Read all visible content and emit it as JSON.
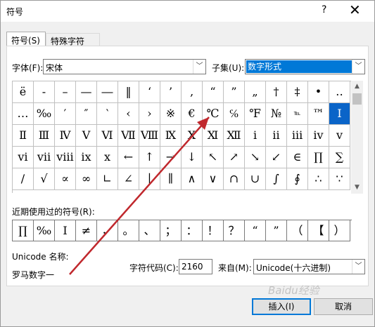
{
  "title": "符号",
  "help_glyph": "?",
  "close_glyph": "✕",
  "tabs": [
    "符号(S)",
    "特殊字符(P)"
  ],
  "font": {
    "label": "字体(F):",
    "value": "宋体"
  },
  "subset": {
    "label": "子集(U):",
    "value": "数字形式"
  },
  "symbols": [
    [
      "ë",
      "-",
      "–",
      "—",
      "―",
      "‖",
      "‘",
      "’",
      "‚",
      "“",
      "”",
      "„",
      "†",
      "‡",
      "•",
      "‥"
    ],
    [
      "…",
      "‰",
      "′",
      "″",
      "‵",
      "‹",
      "›",
      "※",
      "€",
      "℃",
      "℅",
      "℉",
      "№",
      "℡",
      "™",
      "Ⅰ"
    ],
    [
      "Ⅱ",
      "Ⅲ",
      "Ⅳ",
      "Ⅴ",
      "Ⅵ",
      "Ⅶ",
      "Ⅷ",
      "Ⅸ",
      "Ⅹ",
      "Ⅺ",
      "Ⅻ",
      "ⅰ",
      "ⅱ",
      "ⅲ",
      "ⅳ",
      "ⅴ"
    ],
    [
      "ⅵ",
      "ⅶ",
      "ⅷ",
      "ⅸ",
      "ⅹ",
      "←",
      "↑",
      "→",
      "↓",
      "↖",
      "↗",
      "↘",
      "↙",
      "∈",
      "∏",
      "∑"
    ],
    [
      "∕",
      "√",
      "∝",
      "∞",
      "∟",
      "∠",
      "∣",
      "∥",
      "∧",
      "∨",
      "∩",
      "∪",
      "∫",
      "∮",
      "∴",
      "∵"
    ]
  ],
  "selected_symbol": "Ⅰ",
  "recent": {
    "label": "近期使用过的符号(R):",
    "items": [
      "∏",
      "‰",
      "Ⅰ",
      "≠",
      "，",
      "。",
      "、",
      "；",
      "：",
      "！",
      "？",
      "“",
      "”",
      "（",
      "【",
      "）"
    ]
  },
  "unicode_name": {
    "label": "Unicode 名称:",
    "value": "罗马数字一"
  },
  "char_code": {
    "label": "字符代码(C):",
    "value": "2160"
  },
  "from": {
    "label": "来自(M):",
    "value": "Unicode(十六进制)"
  },
  "buttons": {
    "insert": "插入(I)",
    "cancel": "取消"
  },
  "watermark": "Baidu经验",
  "accent_color": "#0078d7",
  "annotation_color": "#c0282d"
}
